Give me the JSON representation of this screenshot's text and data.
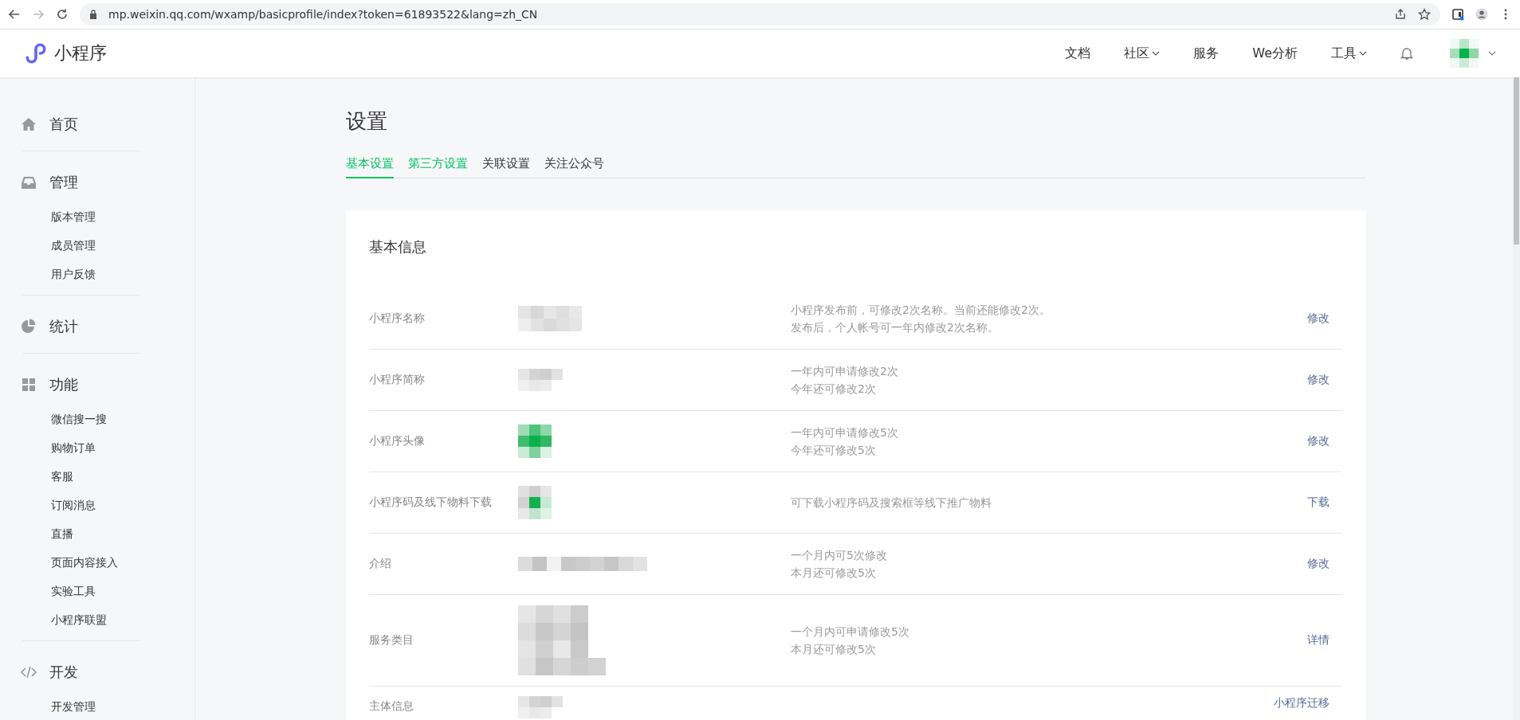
{
  "browser": {
    "url": "mp.weixin.qq.com/wxamp/basicprofile/index?token=61893522&lang=zh_CN"
  },
  "header": {
    "logo": "小程序",
    "nav": [
      {
        "label": "文档",
        "dropdown": false
      },
      {
        "label": "社区",
        "dropdown": true
      },
      {
        "label": "服务",
        "dropdown": false
      },
      {
        "label": "We分析",
        "dropdown": false
      },
      {
        "label": "工具",
        "dropdown": true
      }
    ]
  },
  "sidebar": {
    "groups": [
      {
        "kind": "home",
        "label": "首页"
      },
      {
        "kind": "inbox",
        "label": "管理",
        "children": [
          {
            "label": "版本管理"
          },
          {
            "label": "成员管理"
          },
          {
            "label": "用户反馈"
          }
        ]
      },
      {
        "kind": "pie",
        "label": "统计"
      },
      {
        "kind": "grid",
        "label": "功能",
        "children": [
          {
            "label": "微信搜一搜"
          },
          {
            "label": "购物订单"
          },
          {
            "label": "客服"
          },
          {
            "label": "订阅消息"
          },
          {
            "label": "直播"
          },
          {
            "label": "页面内容接入"
          },
          {
            "label": "实验工具"
          },
          {
            "label": "小程序联盟"
          }
        ]
      },
      {
        "kind": "code",
        "label": "开发",
        "children": [
          {
            "label": "开发管理"
          }
        ]
      }
    ]
  },
  "page": {
    "title": "设置",
    "tabs": [
      {
        "label": "基本设置",
        "selected": true,
        "color": "#07c160"
      },
      {
        "label": "第三方设置",
        "selected": false,
        "color": "#07c160"
      },
      {
        "label": "关联设置",
        "selected": false,
        "color": "#333333"
      },
      {
        "label": "关注公众号",
        "selected": false,
        "color": "#333333"
      }
    ]
  },
  "card": {
    "title": "基本信息",
    "rows": [
      {
        "label": "小程序名称",
        "kind": "text",
        "notes": [
          "小程序发布前，可修改2次名称。当前还能修改2次。",
          "发布后，个人帐号可一年内修改2次名称。"
        ],
        "action": "修改"
      },
      {
        "label": "小程序简称",
        "kind": "short",
        "notes": [
          "一年内可申请修改2次",
          "今年还可修改2次"
        ],
        "action": "修改"
      },
      {
        "label": "小程序头像",
        "kind": "avatar",
        "notes": [
          "一年内可申请修改5次",
          "今年还可修改5次"
        ],
        "action": "修改"
      },
      {
        "label": "小程序码及线下物料下载",
        "kind": "code",
        "notes": [
          "可下载小程序码及搜索框等线下推广物料"
        ],
        "action": "下载"
      },
      {
        "label": "介绍",
        "kind": "long",
        "notes": [
          "一个月内可5次修改",
          "本月还可修改5次"
        ],
        "action": "修改"
      },
      {
        "label": "服务类目",
        "kind": "multi",
        "notes": [
          "一个月内可申请修改5次",
          "本月还可修改5次"
        ],
        "action": "详情"
      },
      {
        "label": "主体信息",
        "kind": "short",
        "notes": [],
        "action": "小程序迁移"
      }
    ]
  }
}
